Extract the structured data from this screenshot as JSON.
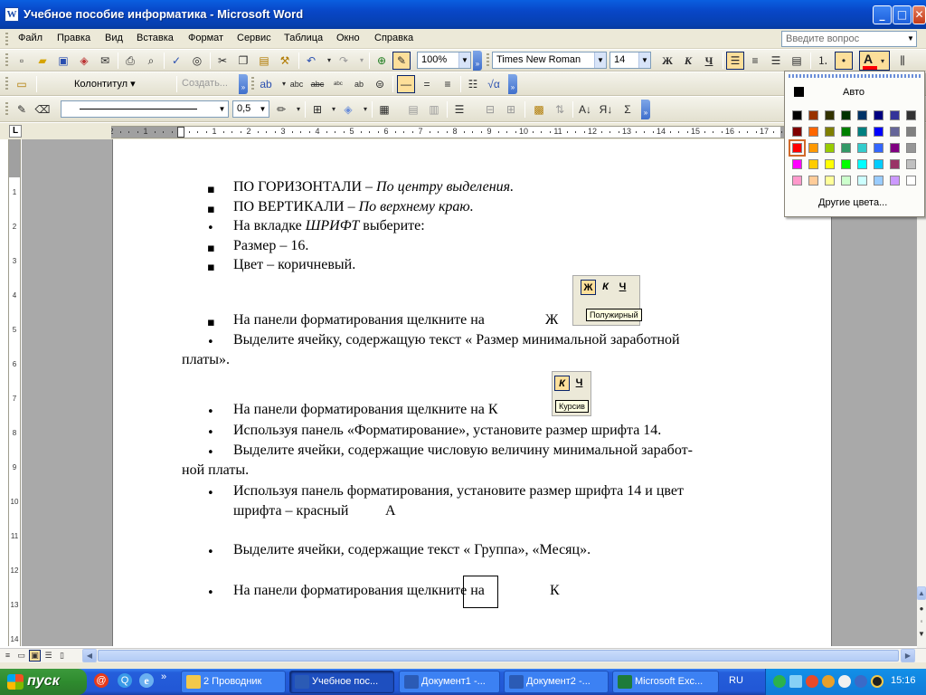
{
  "window": {
    "title": "Учебное пособие информатика - Microsoft Word",
    "icon": "word-doc-icon",
    "minimize": "_",
    "maximize": "□",
    "close": "✕"
  },
  "menu": [
    "Файл",
    "Правка",
    "Вид",
    "Вставка",
    "Формат",
    "Сервис",
    "Таблица",
    "Окно",
    "Справка"
  ],
  "ask_placeholder": "Введите вопрос",
  "standard_toolbar": {
    "zoom": "100%"
  },
  "formatting_toolbar": {
    "font": "Times New Roman",
    "size": "14",
    "bold": "Ж",
    "italic": "К",
    "underline": "Ч",
    "font_color_letter": "A"
  },
  "header_footer_toolbar": {
    "header": "Колонтитул ▾",
    "create": "Создать..."
  },
  "tables_toolbar": {
    "line_weight": "0,5",
    "sum": "Σ"
  },
  "color_picker": {
    "auto_label": "Авто",
    "more_label": "Другие цвета...",
    "selected": "#ff0000",
    "rows": [
      [
        "#000000",
        "#993300",
        "#333300",
        "#003300",
        "#003366",
        "#000080",
        "#333399",
        "#333333"
      ],
      [
        "#800000",
        "#ff6600",
        "#808000",
        "#008000",
        "#008080",
        "#0000ff",
        "#666699",
        "#808080"
      ],
      [
        "#ff0000",
        "#ff9900",
        "#99cc00",
        "#339966",
        "#33cccc",
        "#3366ff",
        "#800080",
        "#969696"
      ],
      [
        "#ff00ff",
        "#ffcc00",
        "#ffff00",
        "#00ff00",
        "#00ffff",
        "#00ccff",
        "#993366",
        "#c0c0c0"
      ],
      [
        "#ff99cc",
        "#ffcc99",
        "#ffff99",
        "#ccffcc",
        "#ccffff",
        "#99ccff",
        "#cc99ff",
        "#ffffff"
      ]
    ]
  },
  "ruler": {
    "h": [
      "2",
      "1",
      "1",
      "1",
      "2",
      "3",
      "4",
      "5",
      "6",
      "7",
      "8",
      "9",
      "10",
      "11",
      "12",
      "13",
      "14",
      "15",
      "16",
      "17"
    ],
    "v": [
      "1",
      "2",
      "3",
      "4",
      "5",
      "6",
      "7",
      "8",
      "9",
      "10",
      "11",
      "12",
      "13",
      "14"
    ]
  },
  "document": {
    "l1a": "ПО ГОРИЗОНТАЛИ – ",
    "l1b": "По центру выделения.",
    "l2a": "ПО ВЕРТИКАЛИ – ",
    "l2b": "По верхнему краю.",
    "l3a": "На вкладке ",
    "l3b": "ШРИФТ",
    "l3c": " выберите:",
    "l4": "Размер – 16.",
    "l5": "Цвет – коричневый.",
    "l6": "На панели форматирования щелкните на",
    "l6sym": "Ж",
    "shot1": {
      "b": "Ж",
      "i": "К",
      "u": "Ч",
      "tip": "Полужирный"
    },
    "l7": "Выделите ячейку, содержащую текст « Размер минимальной заработной",
    "l7b": "платы».",
    "shot2": {
      "i": "К",
      "u": "Ч",
      "tip": "Курсив"
    },
    "l8": "На панели форматирования щелкните на К",
    "l9": "Используя панель «Форматирование», установите размер шрифта 14.",
    "l10": "Выделите ячейки, содержащие  числовую величину минимальной заработ-",
    "l10b": "ной платы.",
    "l11": "Используя панель форматирования, установите размер шрифта 14 и цвет",
    "l11b": "шрифта – красный",
    "l11sym": "А",
    "l12": "Выделите ячейки, содержащие текст « Группа», «Месяц».",
    "l13": "На панели форматирования щелкните на",
    "l13sym": "К"
  },
  "taskbar": {
    "start": "пуск",
    "tasks": [
      {
        "label": "2 Проводник",
        "icon": "folder-icon",
        "color": "#f2c84b"
      },
      {
        "label": "Учебное пос...",
        "icon": "word-icon",
        "color": "#2b5bb5",
        "active": true
      },
      {
        "label": "Документ1 -...",
        "icon": "word-icon",
        "color": "#2b5bb5"
      },
      {
        "label": "Документ2 -...",
        "icon": "word-icon",
        "color": "#2b5bb5"
      },
      {
        "label": "Microsoft Exc...",
        "icon": "excel-icon",
        "color": "#1e7b3a"
      }
    ],
    "lang": "RU",
    "clock": "15:16"
  }
}
